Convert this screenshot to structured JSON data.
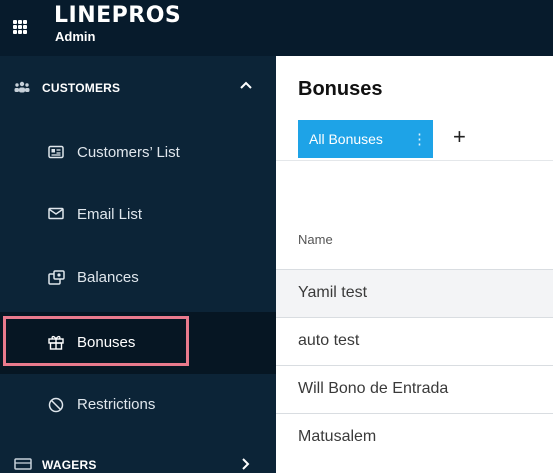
{
  "header": {
    "brand": "LINEPROS",
    "subtitle": "Admin"
  },
  "sidebar": {
    "section_customers": "CUSTOMERS",
    "items": [
      {
        "label": "Customers’ List",
        "icon": "id-card-icon"
      },
      {
        "label": "Email List",
        "icon": "envelope-icon"
      },
      {
        "label": "Balances",
        "icon": "balance-icon"
      },
      {
        "label": "Bonuses",
        "icon": "gift-icon",
        "active": true
      },
      {
        "label": "Restrictions",
        "icon": "block-icon"
      }
    ],
    "section_wagers": "WAGERS"
  },
  "main": {
    "title": "Bonuses",
    "tabs": [
      {
        "label": "All Bonuses",
        "menu_glyph": "⋮"
      }
    ],
    "add_tab": "+",
    "columns": [
      "Name"
    ],
    "rows": [
      "Yamil test",
      "auto test",
      "Will Bono de Entrada",
      "Matusalem"
    ]
  },
  "colors": {
    "topbar": "#071b2c",
    "sidebar": "#0c2437",
    "accent": "#1ea3e7",
    "highlight": "#e97a8d"
  }
}
